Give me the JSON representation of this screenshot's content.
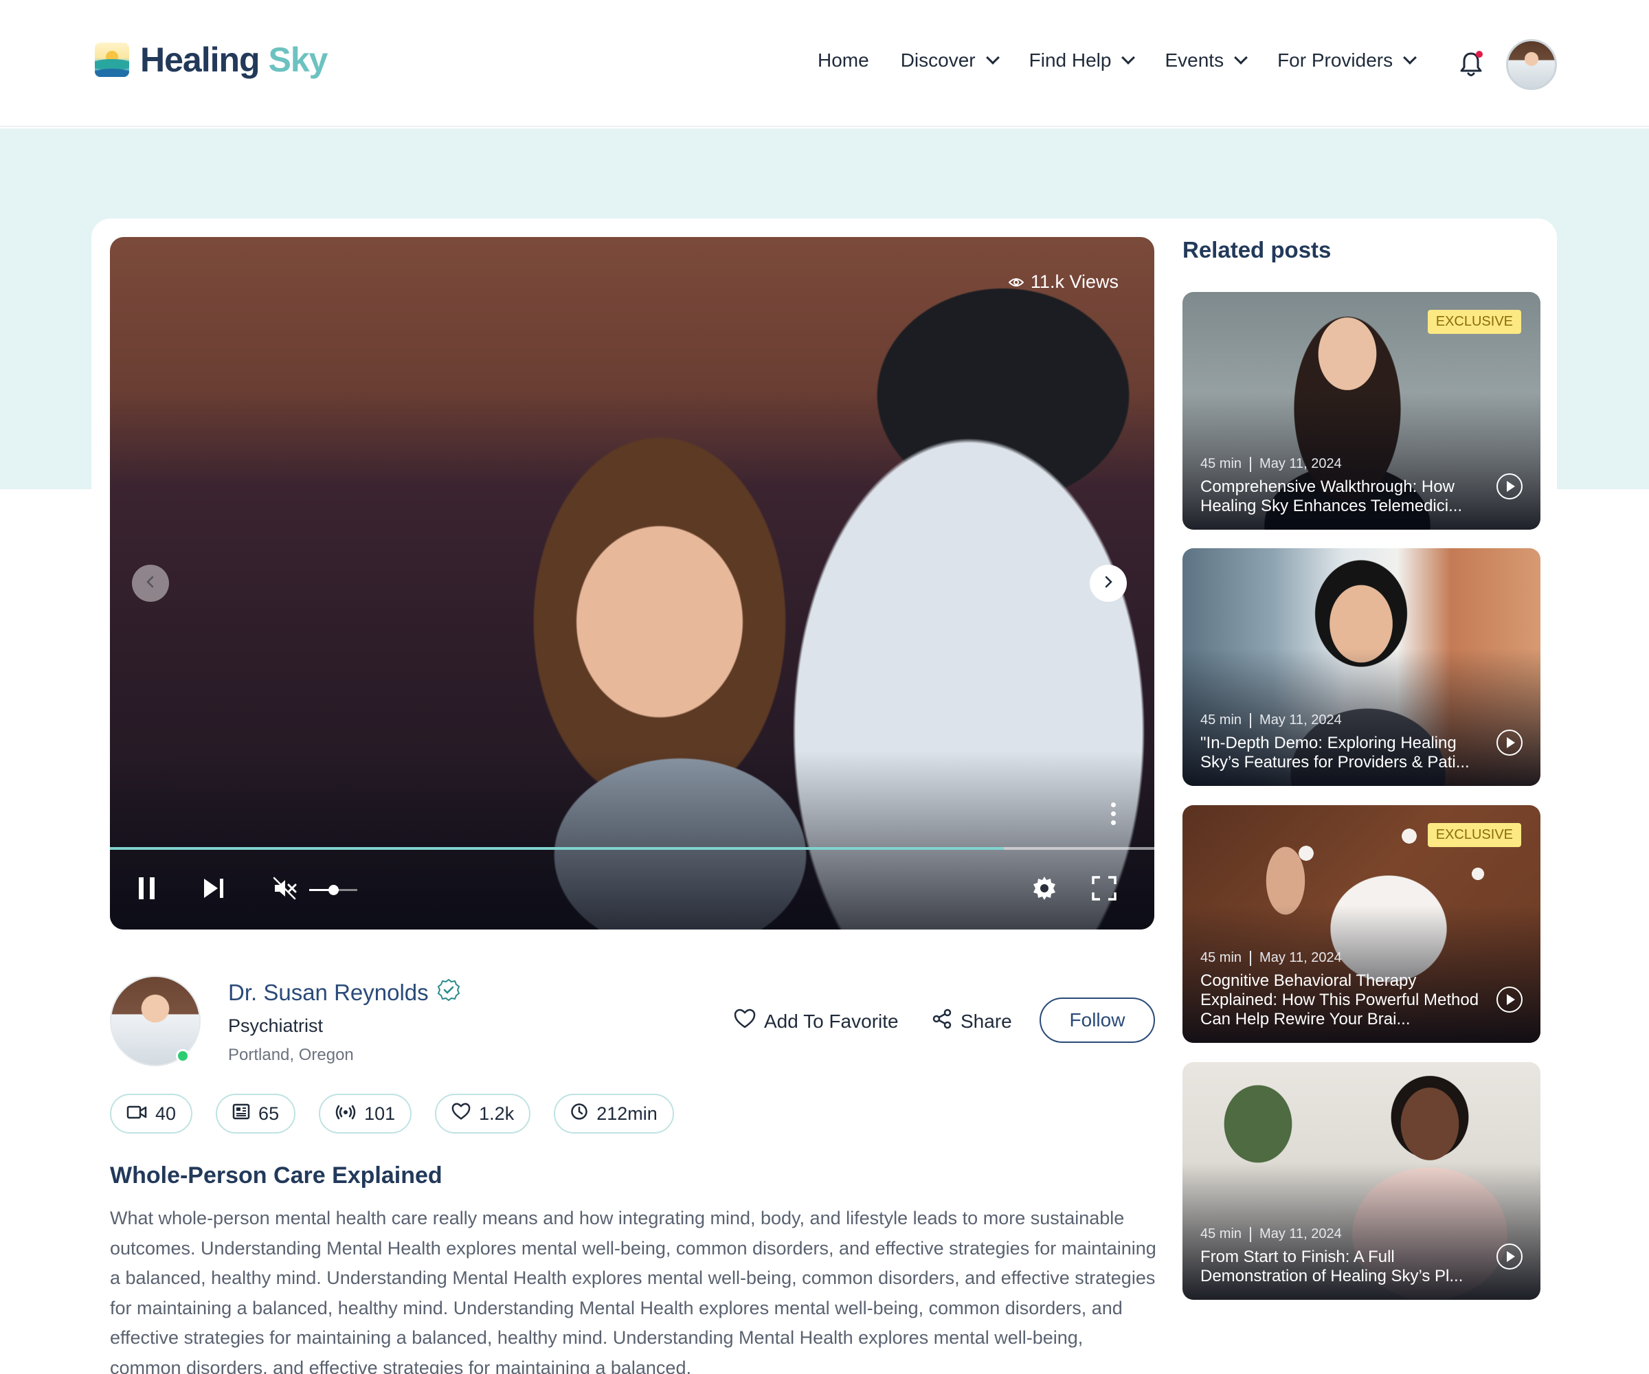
{
  "brand": {
    "word1": "Healing",
    "word2": "Sky"
  },
  "nav": {
    "items": [
      {
        "label": "Home",
        "has_menu": false
      },
      {
        "label": "Discover",
        "has_menu": true
      },
      {
        "label": "Find Help",
        "has_menu": true
      },
      {
        "label": "Events",
        "has_menu": true
      },
      {
        "label": "For Providers",
        "has_menu": true
      }
    ]
  },
  "video": {
    "views": "11.k Views",
    "progress_fraction": 0.856,
    "volume_fraction": 0.5,
    "muted": true,
    "icons": [
      "pause-icon",
      "skip-next-icon",
      "volume-mute-icon",
      "settings-icon",
      "fullscreen-icon",
      "more-vert-icon"
    ]
  },
  "author": {
    "name": "Dr. Susan Reynolds",
    "role": "Psychiatrist",
    "location": "Portland, Oregon",
    "online": true
  },
  "actions": {
    "favorite_label": "Add To Favorite",
    "share_label": "Share",
    "follow_label": "Follow"
  },
  "stats": {
    "videos": "40",
    "articles": "65",
    "live": "101",
    "likes": "1.2k",
    "duration": "212min"
  },
  "post": {
    "title": "Whole-Person Care Explained",
    "body": "What whole-person mental health care really means and how integrating mind, body, and lifestyle leads to more sustainable outcomes. Understanding Mental Health explores mental well-being, common disorders, and effective strategies for maintaining a balanced, healthy mind. Understanding Mental Health explores mental well-being, common disorders, and effective strategies for maintaining a balanced, healthy mind. Understanding Mental Health explores mental well-being, common disorders, and effective strategies for maintaining a balanced, healthy mind. Understanding Mental Health explores mental well-being, common disorders, and effective strategies for maintaining a balanced,"
  },
  "related": {
    "title": "Related posts",
    "items": [
      {
        "duration": "45 min",
        "date": "May 11, 2024",
        "title": "Comprehensive Walkthrough: How Healing Sky Enhances Telemedici...",
        "badge": "EXCLUSIVE"
      },
      {
        "duration": "45 min",
        "date": "May 11, 2024",
        "title": "\"In-Depth Demo: Exploring Healing Sky’s Features for Providers & Pati...",
        "badge": ""
      },
      {
        "duration": "45 min",
        "date": "May 11, 2024",
        "title": "Cognitive Behavioral Therapy Explained: How This Powerful Method Can Help Rewire Your Brai...",
        "badge": "EXCLUSIVE"
      },
      {
        "duration": "45 min",
        "date": "May 11, 2024",
        "title": "From Start to Finish: A Full Demonstration of Healing Sky’s Pl...",
        "badge": ""
      }
    ]
  },
  "colors": {
    "brand_dark": "#22395a",
    "brand_teal": "#6cc2c0",
    "band": "#e4f3f4",
    "accent_link": "#2a4a78",
    "progress": "#7fd3cf",
    "badge": "#fde984",
    "online": "#2ecc71"
  }
}
